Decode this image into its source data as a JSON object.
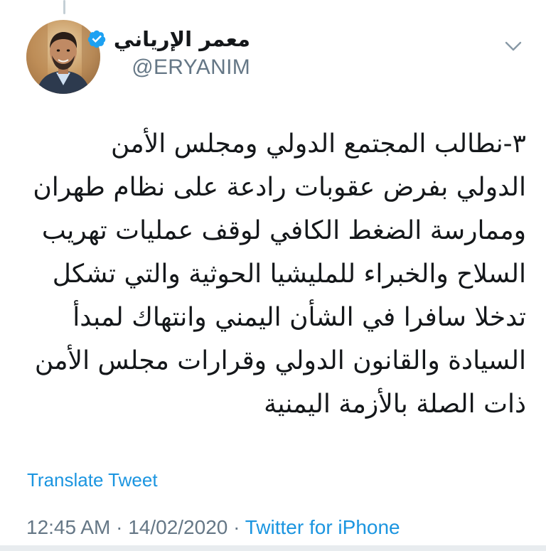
{
  "colors": {
    "link": "#1b95e0",
    "secondary_text": "#657786",
    "primary_text": "#14171a",
    "verified_badge": "#1da1f2"
  },
  "header": {
    "display_name": "معمر الإرياني",
    "handle": "@ERYANIM",
    "verified_icon": "verified-badge-icon",
    "menu_icon": "chevron-down-icon"
  },
  "tweet": {
    "lines": [
      "٣-نطالب المجتمع الدولي ومجلس الأمن",
      "الدولي بفرض عقوبات رادعة على نظام طهران",
      "وممارسة الضغط الكافي لوقف عمليات تهريب",
      "السلاح والخبراء للمليشيا الحوثية والتي تشكل",
      "تدخلا سافرا في الشأن اليمني وانتهاك لمبدأ",
      "السيادة والقانون الدولي وقرارات مجلس الأمن",
      "ذات الصلة بالأزمة اليمنية"
    ],
    "translate_label": "Translate Tweet"
  },
  "meta": {
    "time": "12:45 AM",
    "separator": " · ",
    "date": "14/02/2020",
    "source": "Twitter for iPhone"
  }
}
